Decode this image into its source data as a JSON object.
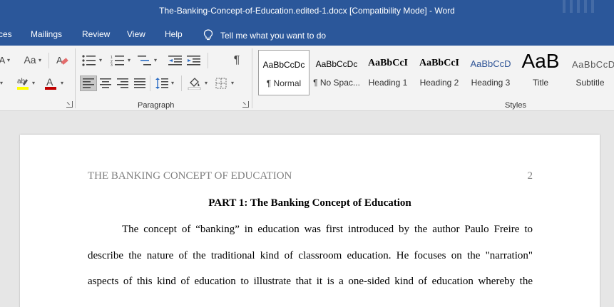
{
  "window": {
    "title": "The-Banking-Concept-of-Education.edited-1.docx [Compatibility Mode]  -  Word"
  },
  "menu": {
    "tabs": [
      "ces",
      "Mailings",
      "Review",
      "View",
      "Help"
    ],
    "tell_me": "Tell me what you want to do"
  },
  "ribbon": {
    "font_group": {
      "change_case": "Aa",
      "clear_format_icon": "eraser-icon",
      "highlight_color": "#ffff00",
      "font_color": "#c00000"
    },
    "paragraph_group": {
      "label": "Paragraph",
      "show_marks": "¶"
    },
    "styles_group": {
      "label": "Styles",
      "items": [
        {
          "sample": "AaBbCcDc",
          "name": "¶ Normal"
        },
        {
          "sample": "AaBbCcDc",
          "name": "¶ No Spac..."
        },
        {
          "sample": "AaBbCcI",
          "name": "Heading 1"
        },
        {
          "sample": "AaBbCcI",
          "name": "Heading 2"
        },
        {
          "sample": "AaBbCcD",
          "name": "Heading 3"
        },
        {
          "sample": "AaB",
          "name": "Title"
        },
        {
          "sample": "AaBbCcD",
          "name": "Subtitle"
        }
      ]
    }
  },
  "document": {
    "header": "THE BANKING CONCEPT OF EDUCATION",
    "page_number": "2",
    "heading": "PART 1: The Banking Concept of Education",
    "lines": [
      "The concept of “banking” in education was first introduced by the author Paulo Freire to",
      "describe the nature of the traditional kind of classroom education. He focuses on the \"narration\"",
      "aspects of this kind of education to illustrate that it is a one-sided kind of education whereby the"
    ]
  }
}
